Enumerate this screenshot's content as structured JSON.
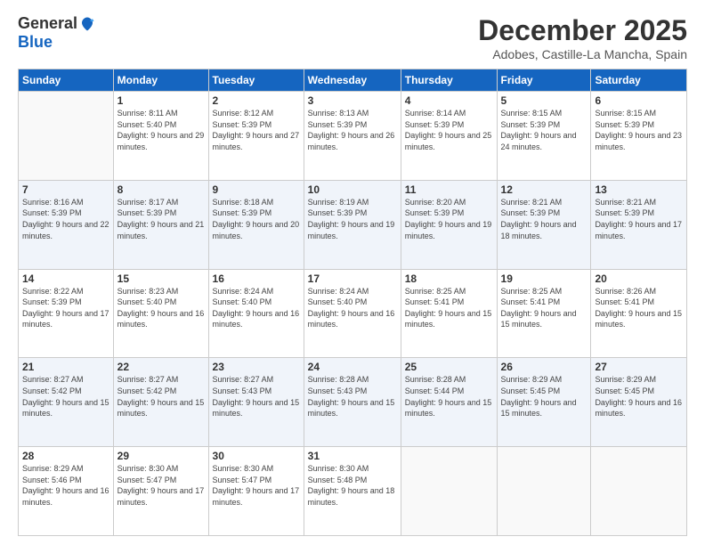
{
  "logo": {
    "general": "General",
    "blue": "Blue"
  },
  "title": "December 2025",
  "subtitle": "Adobes, Castille-La Mancha, Spain",
  "days_header": [
    "Sunday",
    "Monday",
    "Tuesday",
    "Wednesday",
    "Thursday",
    "Friday",
    "Saturday"
  ],
  "weeks": [
    [
      {
        "num": "",
        "sunrise": "",
        "sunset": "",
        "daylight": ""
      },
      {
        "num": "1",
        "sunrise": "8:11 AM",
        "sunset": "5:40 PM",
        "daylight": "9 hours and 29 minutes."
      },
      {
        "num": "2",
        "sunrise": "8:12 AM",
        "sunset": "5:39 PM",
        "daylight": "9 hours and 27 minutes."
      },
      {
        "num": "3",
        "sunrise": "8:13 AM",
        "sunset": "5:39 PM",
        "daylight": "9 hours and 26 minutes."
      },
      {
        "num": "4",
        "sunrise": "8:14 AM",
        "sunset": "5:39 PM",
        "daylight": "9 hours and 25 minutes."
      },
      {
        "num": "5",
        "sunrise": "8:15 AM",
        "sunset": "5:39 PM",
        "daylight": "9 hours and 24 minutes."
      },
      {
        "num": "6",
        "sunrise": "8:15 AM",
        "sunset": "5:39 PM",
        "daylight": "9 hours and 23 minutes."
      }
    ],
    [
      {
        "num": "7",
        "sunrise": "8:16 AM",
        "sunset": "5:39 PM",
        "daylight": "9 hours and 22 minutes."
      },
      {
        "num": "8",
        "sunrise": "8:17 AM",
        "sunset": "5:39 PM",
        "daylight": "9 hours and 21 minutes."
      },
      {
        "num": "9",
        "sunrise": "8:18 AM",
        "sunset": "5:39 PM",
        "daylight": "9 hours and 20 minutes."
      },
      {
        "num": "10",
        "sunrise": "8:19 AM",
        "sunset": "5:39 PM",
        "daylight": "9 hours and 19 minutes."
      },
      {
        "num": "11",
        "sunrise": "8:20 AM",
        "sunset": "5:39 PM",
        "daylight": "9 hours and 19 minutes."
      },
      {
        "num": "12",
        "sunrise": "8:21 AM",
        "sunset": "5:39 PM",
        "daylight": "9 hours and 18 minutes."
      },
      {
        "num": "13",
        "sunrise": "8:21 AM",
        "sunset": "5:39 PM",
        "daylight": "9 hours and 17 minutes."
      }
    ],
    [
      {
        "num": "14",
        "sunrise": "8:22 AM",
        "sunset": "5:39 PM",
        "daylight": "9 hours and 17 minutes."
      },
      {
        "num": "15",
        "sunrise": "8:23 AM",
        "sunset": "5:40 PM",
        "daylight": "9 hours and 16 minutes."
      },
      {
        "num": "16",
        "sunrise": "8:24 AM",
        "sunset": "5:40 PM",
        "daylight": "9 hours and 16 minutes."
      },
      {
        "num": "17",
        "sunrise": "8:24 AM",
        "sunset": "5:40 PM",
        "daylight": "9 hours and 16 minutes."
      },
      {
        "num": "18",
        "sunrise": "8:25 AM",
        "sunset": "5:41 PM",
        "daylight": "9 hours and 15 minutes."
      },
      {
        "num": "19",
        "sunrise": "8:25 AM",
        "sunset": "5:41 PM",
        "daylight": "9 hours and 15 minutes."
      },
      {
        "num": "20",
        "sunrise": "8:26 AM",
        "sunset": "5:41 PM",
        "daylight": "9 hours and 15 minutes."
      }
    ],
    [
      {
        "num": "21",
        "sunrise": "8:27 AM",
        "sunset": "5:42 PM",
        "daylight": "9 hours and 15 minutes."
      },
      {
        "num": "22",
        "sunrise": "8:27 AM",
        "sunset": "5:42 PM",
        "daylight": "9 hours and 15 minutes."
      },
      {
        "num": "23",
        "sunrise": "8:27 AM",
        "sunset": "5:43 PM",
        "daylight": "9 hours and 15 minutes."
      },
      {
        "num": "24",
        "sunrise": "8:28 AM",
        "sunset": "5:43 PM",
        "daylight": "9 hours and 15 minutes."
      },
      {
        "num": "25",
        "sunrise": "8:28 AM",
        "sunset": "5:44 PM",
        "daylight": "9 hours and 15 minutes."
      },
      {
        "num": "26",
        "sunrise": "8:29 AM",
        "sunset": "5:45 PM",
        "daylight": "9 hours and 15 minutes."
      },
      {
        "num": "27",
        "sunrise": "8:29 AM",
        "sunset": "5:45 PM",
        "daylight": "9 hours and 16 minutes."
      }
    ],
    [
      {
        "num": "28",
        "sunrise": "8:29 AM",
        "sunset": "5:46 PM",
        "daylight": "9 hours and 16 minutes."
      },
      {
        "num": "29",
        "sunrise": "8:30 AM",
        "sunset": "5:47 PM",
        "daylight": "9 hours and 17 minutes."
      },
      {
        "num": "30",
        "sunrise": "8:30 AM",
        "sunset": "5:47 PM",
        "daylight": "9 hours and 17 minutes."
      },
      {
        "num": "31",
        "sunrise": "8:30 AM",
        "sunset": "5:48 PM",
        "daylight": "9 hours and 18 minutes."
      },
      {
        "num": "",
        "sunrise": "",
        "sunset": "",
        "daylight": ""
      },
      {
        "num": "",
        "sunrise": "",
        "sunset": "",
        "daylight": ""
      },
      {
        "num": "",
        "sunrise": "",
        "sunset": "",
        "daylight": ""
      }
    ]
  ]
}
